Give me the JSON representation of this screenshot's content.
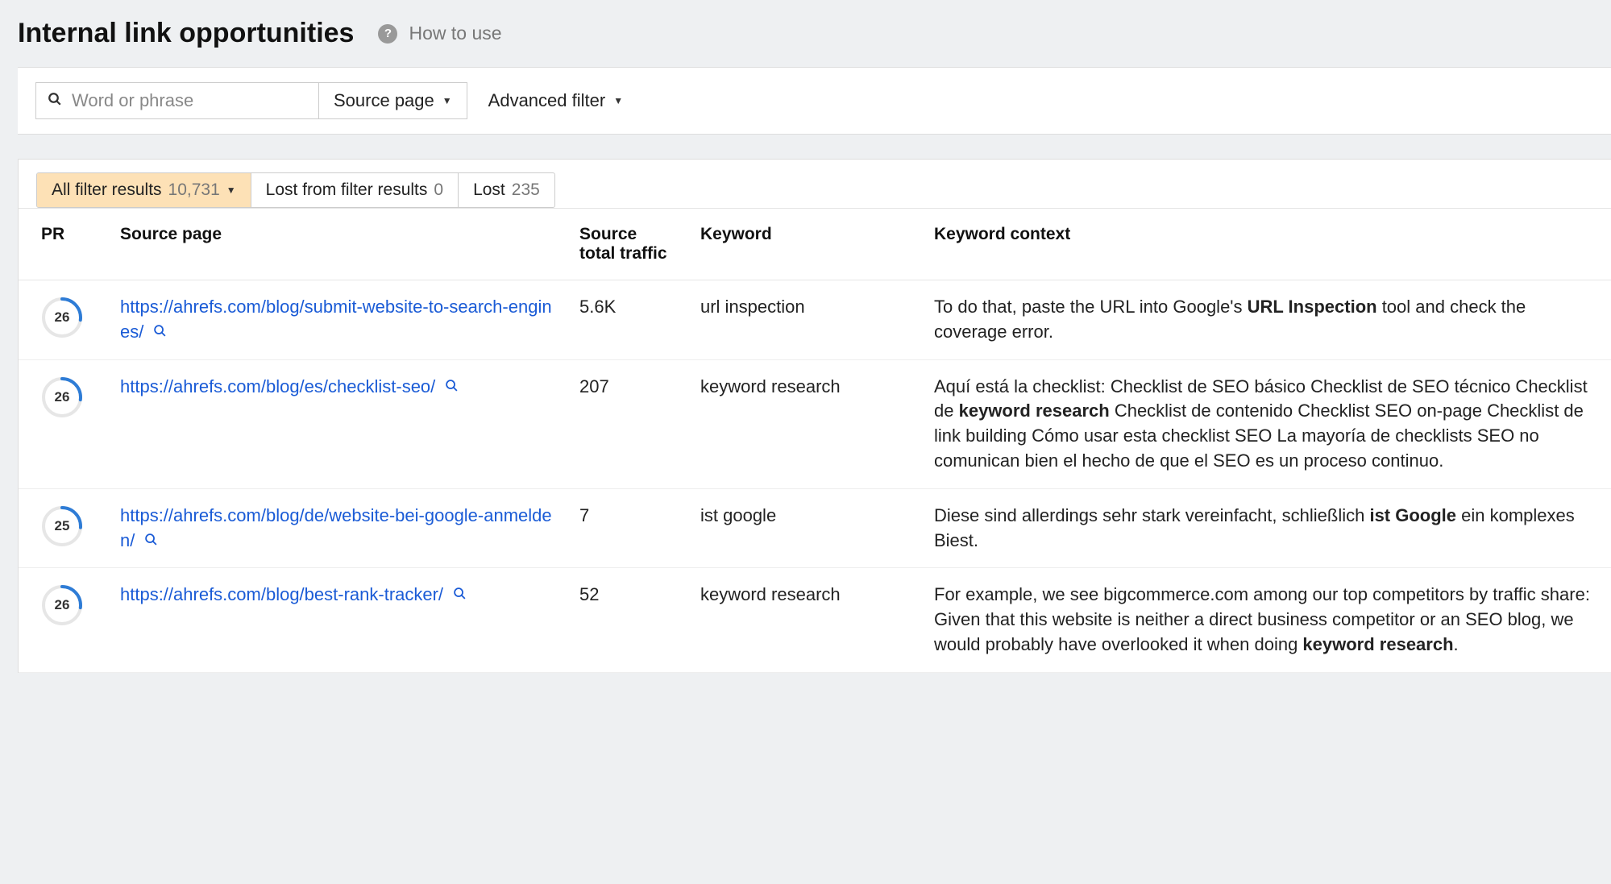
{
  "header": {
    "title": "Internal link opportunities",
    "how_to_use": "How to use"
  },
  "filters": {
    "search_placeholder": "Word or phrase",
    "source_page_label": "Source page",
    "advanced_filter_label": "Advanced filter"
  },
  "tabs": {
    "all": {
      "label": "All filter results",
      "count": "10,731"
    },
    "lost_filter": {
      "label": "Lost from filter results",
      "count": "0"
    },
    "lost": {
      "label": "Lost",
      "count": "235"
    }
  },
  "columns": {
    "pr": "PR",
    "source": "Source page",
    "traffic": "Source total traffic",
    "keyword": "Keyword",
    "context": "Keyword context"
  },
  "rows": [
    {
      "pr": "26",
      "pr_frac": 0.26,
      "url": "https://ahrefs.com/blog/submit-website-to-search-engines/",
      "traffic": "5.6K",
      "keyword": "url inspection",
      "context_pre": "To do that, paste the URL into Google's ",
      "context_bold": "URL Inspection",
      "context_post": " tool and check the coverage error."
    },
    {
      "pr": "26",
      "pr_frac": 0.26,
      "url": "https://ahrefs.com/blog/es/checklist-seo/",
      "traffic": "207",
      "keyword": "keyword research",
      "context_pre": "Aquí está la checklist: Checklist de SEO básico Checklist de SEO técnico Checklist de ",
      "context_bold": "keyword research",
      "context_post": " Checklist de contenido Checklist SEO on-page Checklist de link building Cómo usar esta checklist SEO La mayoría de checklists SEO no comunican bien el hecho de que el SEO es un proceso continuo."
    },
    {
      "pr": "25",
      "pr_frac": 0.25,
      "url": "https://ahrefs.com/blog/de/website-bei-google-anmelden/",
      "traffic": "7",
      "keyword": "ist google",
      "context_pre": "Diese sind allerdings sehr stark vereinfacht, schließlich ",
      "context_bold": "ist Google",
      "context_post": " ein komplexes Biest."
    },
    {
      "pr": "26",
      "pr_frac": 0.26,
      "url": "https://ahrefs.com/blog/best-rank-tracker/",
      "traffic": "52",
      "keyword": "keyword research",
      "context_pre": "For example, we see bigcommerce.com among our top competitors by traffic share: Given that this website is neither a direct business competitor or an SEO blog, we would probably have overlooked it when doing ",
      "context_bold": "keyword research",
      "context_post": "."
    }
  ]
}
